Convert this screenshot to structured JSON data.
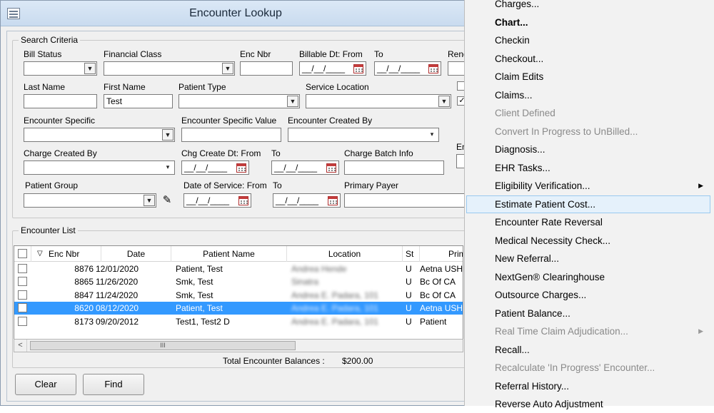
{
  "window": {
    "title": "Encounter Lookup"
  },
  "search": {
    "legend": "Search Criteria",
    "labels": {
      "bill_status": "Bill Status",
      "financial_class": "Financial Class",
      "enc_nbr": "Enc Nbr",
      "billable_dt_from": "Billable Dt:  From",
      "billable_dt_to": "To",
      "rend_truncated": "Rend",
      "last_name": "Last Name",
      "first_name": "First Name",
      "patient_type": "Patient Type",
      "service_location": "Service Location",
      "encounter_specific": "Encounter Specific",
      "encounter_specific_value": "Encounter Specific Value",
      "encounter_created_by": "Encounter Created By",
      "charge_created_by": "Charge Created By",
      "chg_create_dt_from": "Chg Create Dt: From",
      "chg_create_dt_to": "To",
      "charge_batch_info": "Charge Batch Info",
      "en_truncated": "En",
      "patient_group": "Patient Group",
      "dos_from": "Date of Service: From",
      "dos_to": "To",
      "primary_payer": "Primary Payer"
    },
    "values": {
      "first_name": "Test",
      "date_placeholder": "__/__/____"
    },
    "checkbox_checked_mark": "✓"
  },
  "encounter_list": {
    "legend": "Encounter List",
    "columns": [
      "",
      "Enc Nbr",
      "Date",
      "Patient Name",
      "Location",
      "St",
      "Prima"
    ],
    "sort_indicator": "▽",
    "rows": [
      {
        "enc_nbr": "8876",
        "date": "12/01/2020",
        "patient": "Patient, Test",
        "location": "Andrea Hende",
        "st": "U",
        "payer": "Aetna USHC"
      },
      {
        "enc_nbr": "8865",
        "date": "11/26/2020",
        "patient": "Smk, Test",
        "location": "Sinatra",
        "st": "U",
        "payer": "Bc Of CA"
      },
      {
        "enc_nbr": "8847",
        "date": "11/24/2020",
        "patient": "Smk, Test",
        "location": "Andrea E. Padara, 101",
        "st": "U",
        "payer": "Bc Of CA"
      },
      {
        "enc_nbr": "8620",
        "date": "08/12/2020",
        "patient": "Patient, Test",
        "location": "Andrea E. Padara, 101",
        "st": "U",
        "payer": "Aetna USHC"
      },
      {
        "enc_nbr": "8173",
        "date": "09/20/2012",
        "patient": "Test1, Test2 D",
        "location": "Andrea E. Padara, 101",
        "st": "U",
        "payer": "Patient"
      }
    ],
    "selected_row_index": 3,
    "scroll_left_arrow": "<",
    "scroll_thumb_grip": "III",
    "total_label": "Total Encounter Balances :",
    "total_value": "$200.00"
  },
  "buttons": {
    "clear": "Clear",
    "find": "Find"
  },
  "context_menu": {
    "items": [
      {
        "label": "Charges...",
        "state": "normal"
      },
      {
        "label": "Chart...",
        "state": "bold"
      },
      {
        "label": "Checkin",
        "state": "normal"
      },
      {
        "label": "Checkout...",
        "state": "normal"
      },
      {
        "label": "Claim Edits",
        "state": "normal"
      },
      {
        "label": "Claims...",
        "state": "normal"
      },
      {
        "label": "Client Defined",
        "state": "disabled"
      },
      {
        "label": "Convert In Progress to UnBilled...",
        "state": "disabled"
      },
      {
        "label": "Diagnosis...",
        "state": "normal"
      },
      {
        "label": "EHR Tasks...",
        "state": "normal"
      },
      {
        "label": "Eligibility Verification...",
        "state": "normal",
        "submenu": true
      },
      {
        "label": "Estimate Patient Cost...",
        "state": "highlighted"
      },
      {
        "label": "Encounter Rate Reversal",
        "state": "normal"
      },
      {
        "label": "Medical Necessity Check...",
        "state": "normal"
      },
      {
        "label": "New Referral...",
        "state": "normal"
      },
      {
        "label": "NextGen® Clearinghouse",
        "state": "normal"
      },
      {
        "label": "Outsource Charges...",
        "state": "normal"
      },
      {
        "label": "Patient Balance...",
        "state": "normal"
      },
      {
        "label": "Real Time Claim Adjudication...",
        "state": "disabled",
        "submenu": true
      },
      {
        "label": "Recall...",
        "state": "normal"
      },
      {
        "label": "Recalculate 'In Progress' Encounter...",
        "state": "disabled"
      },
      {
        "label": "Referral History...",
        "state": "normal"
      },
      {
        "label": "Reverse Auto Adjustment",
        "state": "normal"
      }
    ],
    "submenu_arrow": "▶"
  },
  "colors": {
    "selection": "#3399ff",
    "menu_highlight": "#e5f1fb",
    "menu_highlight_border": "#99c9ef"
  }
}
